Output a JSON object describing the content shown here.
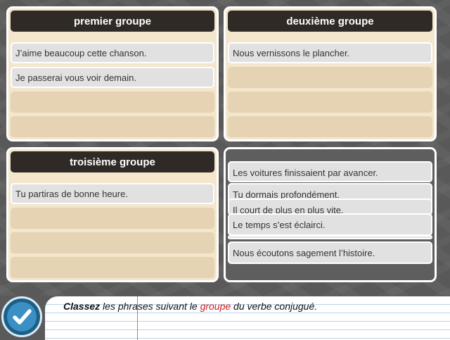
{
  "panels": {
    "premier": {
      "title": "premier groupe",
      "cards": [
        "J’aime beaucoup cette chanson.",
        "Je passerai vous voir demain."
      ]
    },
    "deuxieme": {
      "title": "deuxième groupe",
      "cards": [
        "Nous vernissons le plancher."
      ]
    },
    "troisieme": {
      "title": "troisième groupe",
      "cards": [
        "Tu partiras de bonne heure."
      ]
    }
  },
  "pool": {
    "cards": [
      "Les voitures finissaient par avancer.",
      "Tu dormais profondément.",
      "Il court de plus en plus vite.",
      "Le temps s’est éclairci.",
      "",
      "Nous écoutons sagement l’histoire."
    ]
  },
  "instruction": {
    "verb": "Classez",
    "part1": " les phrases suivant le ",
    "highlight": "groupe",
    "part2": " du verbe conjugué."
  },
  "colors": {
    "header_bg": "#2f2a25",
    "panel_bg": "#f3e6cc",
    "slot_bg": "#e5d3b3",
    "card_bg": "#e1e1e1",
    "highlight": "#d11a1a",
    "check_button": "#3a8fc4"
  },
  "icons": {
    "check_button": "checkmark-icon"
  }
}
